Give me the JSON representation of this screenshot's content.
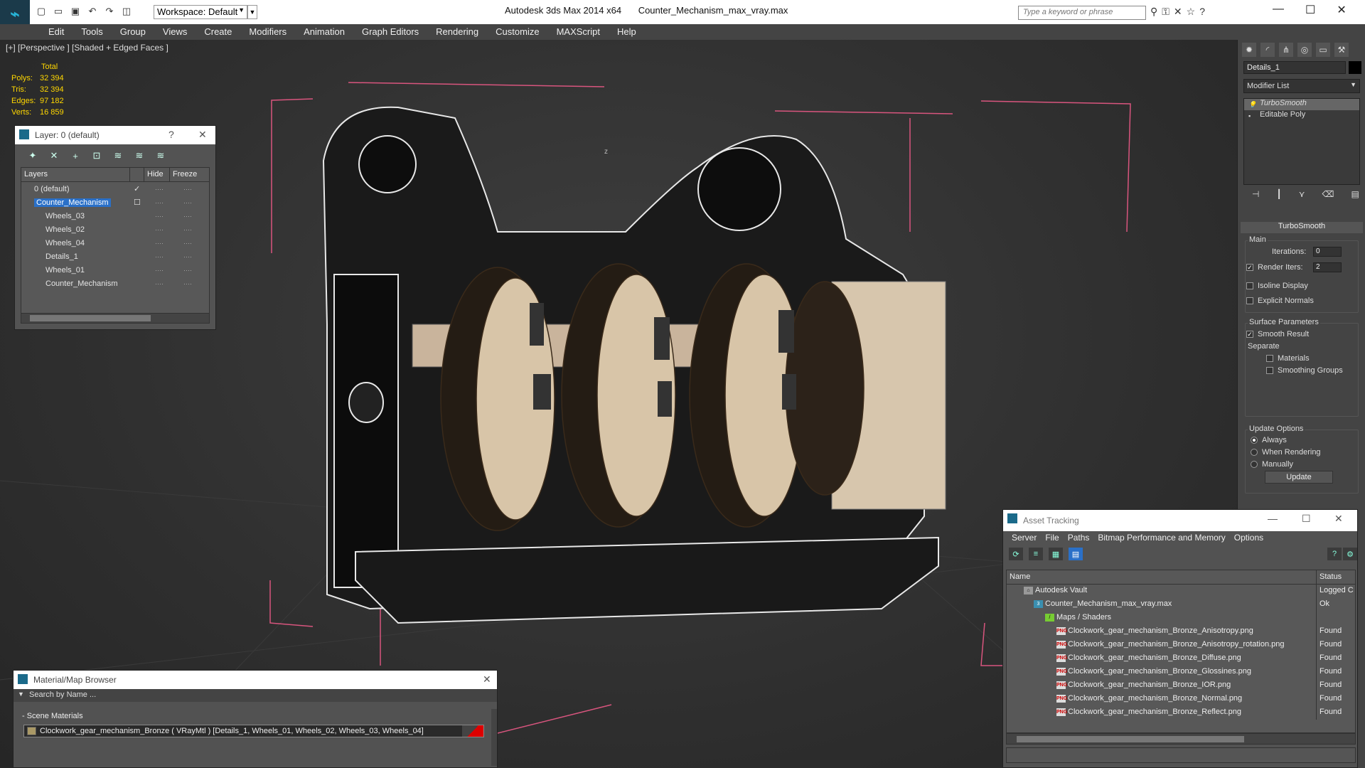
{
  "titlebar": {
    "workspace": "Workspace: Default",
    "app_name": "Autodesk 3ds Max  2014 x64",
    "file_name": "Counter_Mechanism_max_vray.max",
    "search_placeholder": "Type a keyword or phrase"
  },
  "menu": [
    "Edit",
    "Tools",
    "Group",
    "Views",
    "Create",
    "Modifiers",
    "Animation",
    "Graph Editors",
    "Rendering",
    "Customize",
    "MAXScript",
    "Help"
  ],
  "viewport": {
    "label": "[+] [Perspective ] [Shaded + Edged Faces ]",
    "stats": {
      "header": "Total",
      "rows": [
        {
          "label": "Polys:",
          "value": "32 394"
        },
        {
          "label": "Tris:",
          "value": "32 394"
        },
        {
          "label": "Edges:",
          "value": "97 182"
        },
        {
          "label": "Verts:",
          "value": "16 859"
        }
      ]
    },
    "axis_label": "z"
  },
  "layer_window": {
    "title": "Layer: 0 (default)",
    "help": "?",
    "cols": {
      "layers": "Layers",
      "hide": "Hide",
      "freeze": "Freeze"
    },
    "rows": [
      {
        "name": "0 (default)",
        "level": 0,
        "selected": false,
        "active": true
      },
      {
        "name": "Counter_Mechanism",
        "level": 0,
        "selected": true,
        "active": false
      },
      {
        "name": "Wheels_03",
        "level": 1,
        "selected": false,
        "active": false
      },
      {
        "name": "Wheels_02",
        "level": 1,
        "selected": false,
        "active": false
      },
      {
        "name": "Wheels_04",
        "level": 1,
        "selected": false,
        "active": false
      },
      {
        "name": "Details_1",
        "level": 1,
        "selected": false,
        "active": false
      },
      {
        "name": "Wheels_01",
        "level": 1,
        "selected": false,
        "active": false
      },
      {
        "name": "Counter_Mechanism",
        "level": 1,
        "selected": false,
        "active": false
      }
    ]
  },
  "command_panel": {
    "object_name": "Details_1",
    "modifier_list": "Modifier List",
    "stack": [
      {
        "name": "TurboSmooth",
        "selected": true
      },
      {
        "name": "Editable Poly",
        "selected": false
      }
    ],
    "rollout": "TurboSmooth",
    "main_group": "Main",
    "iterations_label": "Iterations:",
    "iterations": "0",
    "render_iters_label": "Render Iters:",
    "render_iters": "2",
    "render_iters_checked": true,
    "isoline_display": "Isoline Display",
    "explicit_normals": "Explicit Normals",
    "surface_params": "Surface Parameters",
    "smooth_result": "Smooth Result",
    "separate": "Separate",
    "materials": "Materials",
    "smoothing_groups": "Smoothing Groups",
    "update_options": "Update Options",
    "always": "Always",
    "when_rendering": "When Rendering",
    "manually": "Manually",
    "update": "Update"
  },
  "asset_window": {
    "title": "Asset Tracking",
    "menu": [
      "Server",
      "File",
      "Paths",
      "Bitmap Performance and Memory",
      "Options"
    ],
    "cols": {
      "name": "Name",
      "status": "Status"
    },
    "rows": [
      {
        "name": "Autodesk Vault",
        "status": "Logged C",
        "level": 0,
        "icon": "vault"
      },
      {
        "name": "Counter_Mechanism_max_vray.max",
        "status": "Ok",
        "level": 1,
        "icon": "max"
      },
      {
        "name": "Maps / Shaders",
        "status": "",
        "level": 2,
        "icon": "fold"
      },
      {
        "name": "Clockwork_gear_mechanism_Bronze_Anisotropy.png",
        "status": "Found",
        "level": 3,
        "icon": "png"
      },
      {
        "name": "Clockwork_gear_mechanism_Bronze_Anisotropy_rotation.png",
        "status": "Found",
        "level": 3,
        "icon": "png"
      },
      {
        "name": "Clockwork_gear_mechanism_Bronze_Diffuse.png",
        "status": "Found",
        "level": 3,
        "icon": "png"
      },
      {
        "name": "Clockwork_gear_mechanism_Bronze_Glossines.png",
        "status": "Found",
        "level": 3,
        "icon": "png"
      },
      {
        "name": "Clockwork_gear_mechanism_Bronze_IOR.png",
        "status": "Found",
        "level": 3,
        "icon": "png"
      },
      {
        "name": "Clockwork_gear_mechanism_Bronze_Normal.png",
        "status": "Found",
        "level": 3,
        "icon": "png"
      },
      {
        "name": "Clockwork_gear_mechanism_Bronze_Reflect.png",
        "status": "Found",
        "level": 3,
        "icon": "png"
      }
    ]
  },
  "material_window": {
    "title": "Material/Map Browser",
    "search_placeholder": "Search by Name ...",
    "section": "- Scene Materials",
    "material": "Clockwork_gear_mechanism_Bronze  ( VRayMtl )  [Details_1, Wheels_01, Wheels_02, Wheels_03, Wheels_04]"
  }
}
